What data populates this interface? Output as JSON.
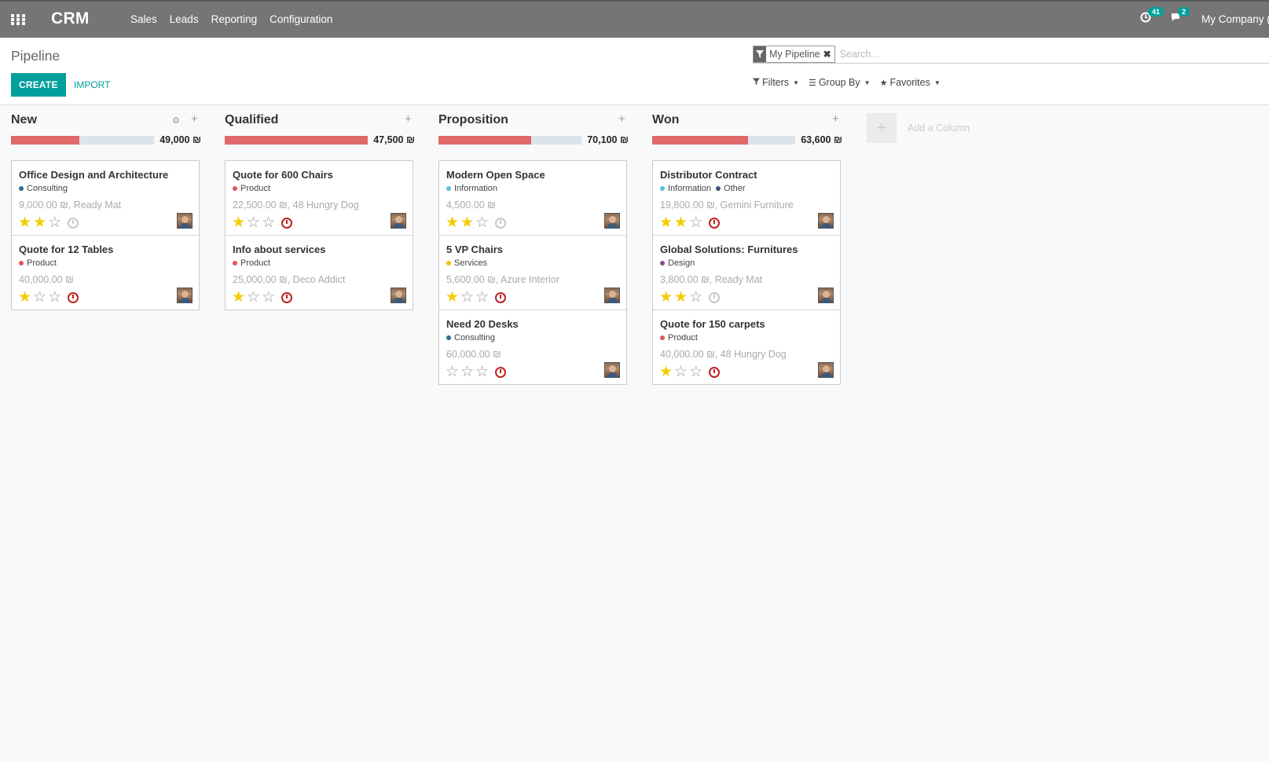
{
  "navbar": {
    "app_name": "CRM",
    "menu": [
      "Sales",
      "Leads",
      "Reporting",
      "Configuration"
    ],
    "activity_count": "41",
    "messages_count": "2",
    "company": "My Company (San Francisco)"
  },
  "control_panel": {
    "breadcrumb": "Pipeline",
    "create_label": "CREATE",
    "import_label": "IMPORT",
    "facet_value": "My Pipeline",
    "search_placeholder": "Search...",
    "filters_label": "Filters",
    "groupby_label": "Group By",
    "favorites_label": "Favorites"
  },
  "add_column_label": "Add a Column",
  "currency": "₪",
  "columns": [
    {
      "title": "New",
      "total": "49,000 ₪",
      "progress": 0.48,
      "has_gear": true,
      "cards": [
        {
          "title": "Office Design and Architecture",
          "tags": [
            {
              "label": "Consulting",
              "color": "#2d6f8f"
            }
          ],
          "amount": "9,000.00 ₪, Ready Mat",
          "stars": 2,
          "overdue": false
        },
        {
          "title": "Quote for 12 Tables",
          "tags": [
            {
              "label": "Product",
              "color": "#e05656"
            }
          ],
          "amount": "40,000.00 ₪",
          "stars": 1,
          "overdue": true
        }
      ]
    },
    {
      "title": "Qualified",
      "total": "47,500 ₪",
      "progress": 1.0,
      "has_gear": false,
      "cards": [
        {
          "title": "Quote for 600 Chairs",
          "tags": [
            {
              "label": "Product",
              "color": "#e05656"
            }
          ],
          "amount": "22,500.00 ₪, 48 Hungry Dog",
          "stars": 1,
          "overdue": true
        },
        {
          "title": "Info about services",
          "tags": [
            {
              "label": "Product",
              "color": "#e05656"
            }
          ],
          "amount": "25,000.00 ₪, Deco Addict",
          "stars": 1,
          "overdue": true
        }
      ]
    },
    {
      "title": "Proposition",
      "total": "70,100 ₪",
      "progress": 0.65,
      "has_gear": false,
      "cards": [
        {
          "title": "Modern Open Space",
          "tags": [
            {
              "label": "Information",
              "color": "#5bc0de"
            }
          ],
          "amount": "4,500.00 ₪",
          "stars": 2,
          "overdue": false
        },
        {
          "title": "5 VP Chairs",
          "tags": [
            {
              "label": "Services",
              "color": "#f0c000"
            }
          ],
          "amount": "5,600.00 ₪, Azure Interior",
          "stars": 1,
          "overdue": true
        },
        {
          "title": "Need 20 Desks",
          "tags": [
            {
              "label": "Consulting",
              "color": "#2d6f8f"
            }
          ],
          "amount": "60,000.00 ₪",
          "stars": 0,
          "overdue": true
        }
      ]
    },
    {
      "title": "Won",
      "total": "63,600 ₪",
      "progress": 0.67,
      "has_gear": false,
      "cards": [
        {
          "title": "Distributor Contract",
          "tags": [
            {
              "label": "Information",
              "color": "#5bc0de"
            },
            {
              "label": "Other",
              "color": "#3d4f7a"
            }
          ],
          "amount": "19,800.00 ₪, Gemini Furniture",
          "stars": 2,
          "overdue": true
        },
        {
          "title": "Global Solutions: Furnitures",
          "tags": [
            {
              "label": "Design",
              "color": "#8e4d8a"
            }
          ],
          "amount": "3,800.00 ₪, Ready Mat",
          "stars": 2,
          "overdue": false
        },
        {
          "title": "Quote for 150 carpets",
          "tags": [
            {
              "label": "Product",
              "color": "#e05656"
            }
          ],
          "amount": "40,000.00 ₪, 48 Hungry Dog",
          "stars": 1,
          "overdue": true
        }
      ]
    }
  ]
}
